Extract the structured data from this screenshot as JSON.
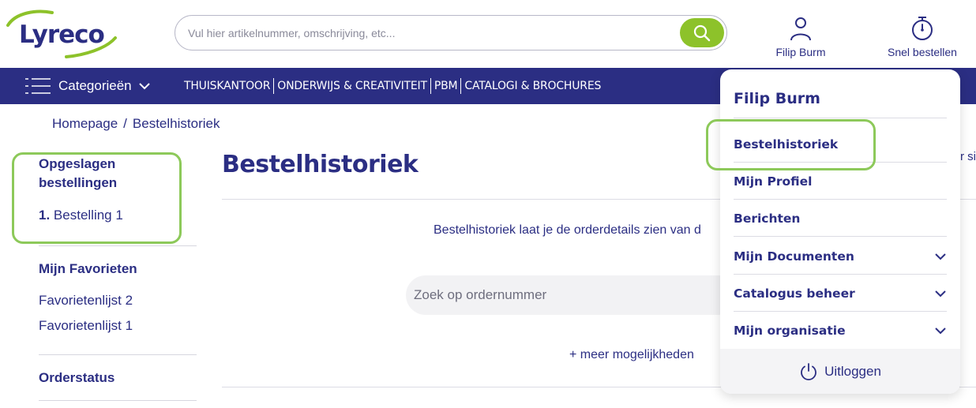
{
  "header": {
    "logo_text": "Lyreco",
    "search_placeholder": "Vul hier artikelnummer, omschrijving, etc...",
    "user_label": "Filip Burm",
    "quick_order_label": "Snel bestellen"
  },
  "nav": {
    "categories_label": "Categorieën",
    "links": [
      "THUISKANTOOR",
      "ONDERWIJS & CREATIVITEIT",
      "PBM",
      "CATALOGI & BROCHURES"
    ]
  },
  "breadcrumb": {
    "home": "Homepage",
    "separator": "/",
    "current": "Bestelhistoriek"
  },
  "sidebar": {
    "saved_orders_title_line1": "Opgeslagen",
    "saved_orders_title_line2": "bestellingen",
    "saved_order_number": "1.",
    "saved_order_name": "Bestelling 1",
    "favorites_title": "Mijn Favorieten",
    "favorites": [
      "Favorietenlijst 2",
      "Favorietenlijst 1"
    ],
    "order_status_title": "Orderstatus"
  },
  "main": {
    "title": "Bestelhistoriek",
    "description": "Bestelhistoriek laat je de orderdetails zien van d",
    "order_search_placeholder": "Zoek op ordernummer",
    "more_options": "+ meer mogelijkheden",
    "cutoff_text": "r si"
  },
  "dropdown": {
    "user_name": "Filip Burm",
    "items": [
      {
        "label": "Bestelhistoriek",
        "has_chevron": false
      },
      {
        "label": "Mijn Profiel",
        "has_chevron": false
      },
      {
        "label": "Berichten",
        "has_chevron": false
      },
      {
        "label": "Mijn Documenten",
        "has_chevron": true
      },
      {
        "label": "Catalogus beheer",
        "has_chevron": true
      },
      {
        "label": "Mijn organisatie",
        "has_chevron": true
      }
    ],
    "logout_label": "Uitloggen"
  },
  "colors": {
    "brand_blue": "#2b2e83",
    "brand_green": "#8dc22a",
    "highlight_green": "#8dc95a"
  }
}
